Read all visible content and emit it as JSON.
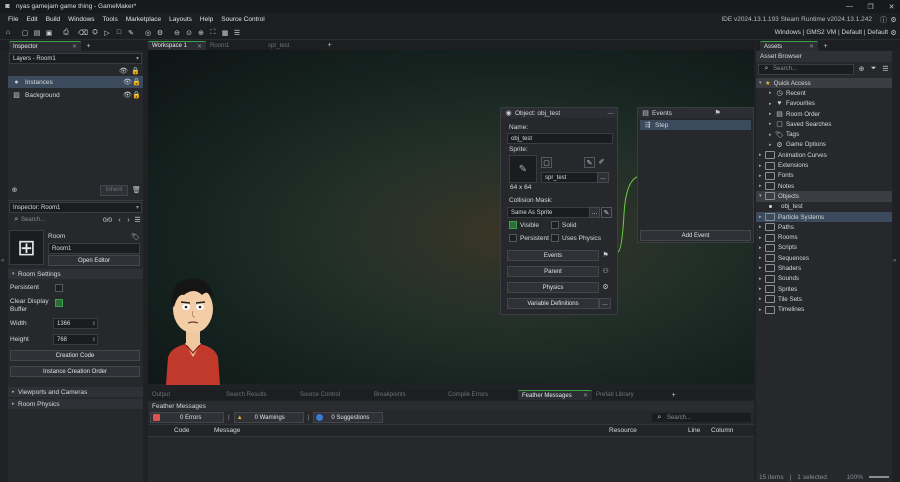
{
  "window": {
    "title": "nyas gamejam game thing - GameMaker*",
    "ide_info": "IDE v2024.13.1.193 Steam  Runtime v2024.13.1.242",
    "target_info": "Windows | GMS2 VM | Default | Default"
  },
  "menu": [
    "File",
    "Edit",
    "Build",
    "Windows",
    "Tools",
    "Marketplace",
    "Layouts",
    "Help",
    "Source Control"
  ],
  "inspector": {
    "tab": "Inspector",
    "layers_dropdown": "Layers - Room1",
    "layers": [
      "Instances",
      "Background"
    ],
    "inherit_label": "Inherit",
    "room_inspector_dropdown": "Inspector: Room1",
    "search_placeholder": "Search...",
    "count": "0/0",
    "room_label": "Room",
    "room_name": "Room1",
    "open_editor": "Open Editor",
    "room_settings": "Room Settings",
    "persistent": "Persistent",
    "clear_display_buffer": "Clear Display Buffer",
    "width_label": "Width",
    "width_value": "1366",
    "height_label": "Height",
    "height_value": "768",
    "creation_code": "Creation Code",
    "instance_creation_order": "Instance Creation Order",
    "viewports": "Viewports and Cameras",
    "room_physics": "Room Physics"
  },
  "editor_tabs": [
    {
      "label": "Workspace 1",
      "active": true
    },
    {
      "label": "Room1",
      "active": false
    },
    {
      "label": "spr_test",
      "active": false
    }
  ],
  "object_editor": {
    "title": "Object: obj_test",
    "name_label": "Name:",
    "name_value": "obj_test",
    "sprite_label": "Sprite:",
    "sprite_size": "64 x 64",
    "sprite_name": "spr_test",
    "collision_label": "Collision Mask:",
    "collision_value": "Same As Sprite",
    "visible": "Visible",
    "solid": "Solid",
    "persistent": "Persistent",
    "uses_physics": "Uses Physics",
    "events_btn": "Events",
    "parent_btn": "Parent",
    "physics_btn": "Physics",
    "variable_defs": "Variable Definitions"
  },
  "events_panel": {
    "title": "Events",
    "event": "Step",
    "add_event": "Add Event"
  },
  "bottom": {
    "tabs": [
      "Output",
      "Search Results",
      "Source Control",
      "Breakpoints",
      "Compile Errors",
      "Feather Messages",
      "Prefab Library"
    ],
    "active_tab": "Feather Messages",
    "section_title": "Feather Messages",
    "errors": "0 Errors",
    "warnings": "0 Warnings",
    "suggestions": "0 Suggestions",
    "search_placeholder": "Search...",
    "columns": [
      "Code",
      "Message",
      "Resource",
      "Line",
      "Column"
    ]
  },
  "assets": {
    "tab": "Assets",
    "browser_title": "Asset Browser",
    "search_placeholder": "Search...",
    "quick_access": "Quick Access",
    "quick_items": [
      "Recent",
      "Favourites",
      "Room Order",
      "Saved Searches",
      "Tags",
      "Game Options"
    ],
    "folders": [
      "Animation Curves",
      "Extensions",
      "Fonts",
      "Notes",
      "Objects"
    ],
    "object_child": "obj_test",
    "folders_after": [
      "Particle Systems",
      "Paths",
      "Rooms",
      "Scripts",
      "Sequences",
      "Shaders",
      "Sounds",
      "Sprites",
      "Tile Sets",
      "Timelines"
    ],
    "status_items": "15 items",
    "status_selected": "1 selected",
    "zoom": "100%"
  },
  "colors": {
    "accent_green": "#3aa34a",
    "selection": "#3b4a5c",
    "error_red": "#d9534f",
    "warning_yellow": "#e0b43a",
    "info_blue": "#3a7bd5"
  }
}
